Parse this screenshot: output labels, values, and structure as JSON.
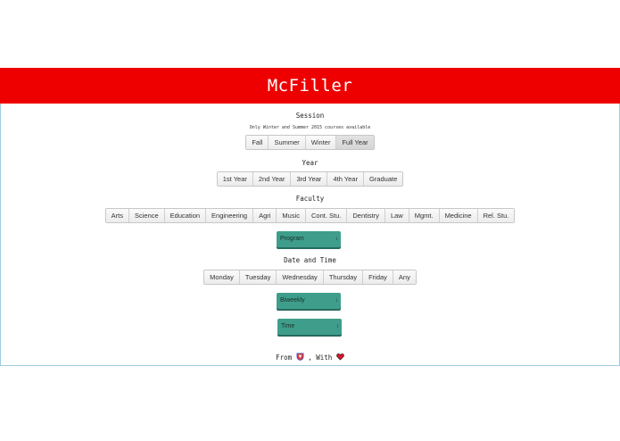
{
  "header": {
    "title": "McFiller"
  },
  "session": {
    "label": "Session",
    "note": "Only Winter and Summer 2015 courses available",
    "options": [
      "Fall",
      "Summer",
      "Winter",
      "Full Year"
    ],
    "selected": "Full Year"
  },
  "year": {
    "label": "Year",
    "options": [
      "1st Year",
      "2nd Year",
      "3rd Year",
      "4th Year",
      "Graduate"
    ]
  },
  "faculty": {
    "label": "Faculty",
    "options": [
      "Arts",
      "Science",
      "Education",
      "Engineering",
      "Agri",
      "Music",
      "Cont. Stu.",
      "Dentistry",
      "Law",
      "Mgmt.",
      "Medicine",
      "Rel. Stu."
    ]
  },
  "program_select": {
    "value": "Program"
  },
  "datetime": {
    "label": "Date and Time",
    "days": [
      "Monday",
      "Tuesday",
      "Wednesday",
      "Thursday",
      "Friday",
      "Any"
    ]
  },
  "frequency_select": {
    "value": "Biweekly"
  },
  "time_select": {
    "value": "Time"
  },
  "footer": {
    "prefix": "From",
    "middle": ", With"
  },
  "colors": {
    "banner": "#ee0000",
    "select": "#3e9e8b"
  }
}
